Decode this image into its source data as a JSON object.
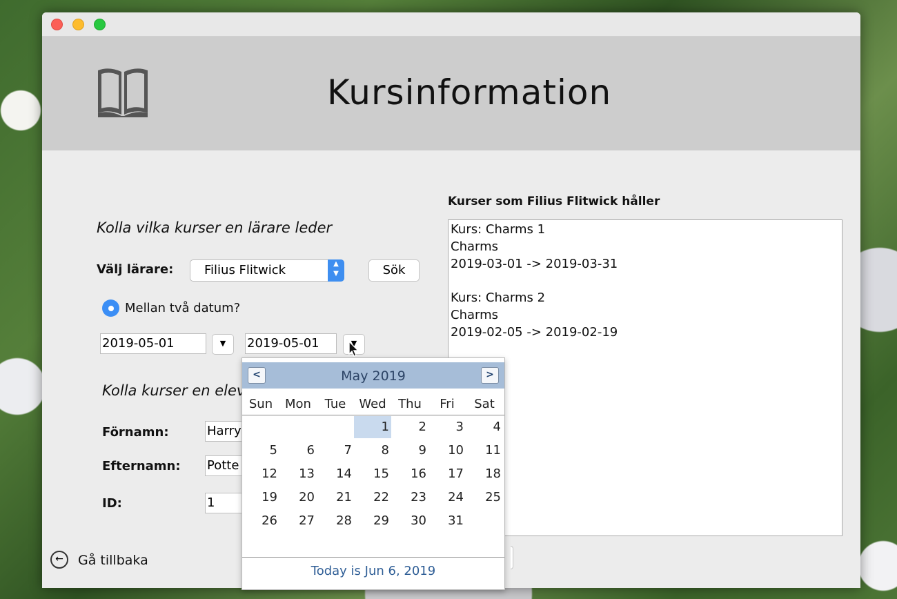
{
  "window": {
    "title": "Kursinformation"
  },
  "teacher_section": {
    "heading": "Kolla vilka kurser en lärare leder",
    "select_label": "Välj lärare:",
    "selected_teacher": "Filius Flitwick",
    "search_button": "Sök",
    "radio_label": "Mellan två datum?",
    "date_from": "2019-05-01",
    "date_to": "2019-05-01"
  },
  "student_section": {
    "heading": "Kolla kurser en elev",
    "firstname_label": "Förnamn:",
    "firstname_value": "Harry",
    "lastname_label": "Efternamn:",
    "lastname_value": "Potte",
    "id_label": "ID:",
    "id_value": "1"
  },
  "results": {
    "heading": "Kurser som Filius Flitwick håller",
    "lines": [
      "Kurs: Charms 1",
      "Charms",
      "2019-03-01 -> 2019-03-31",
      "",
      "Kurs: Charms 2",
      "Charms",
      "2019-02-05 -> 2019-02-19"
    ]
  },
  "back_button": {
    "label": "Gå tillbaka"
  },
  "calendar": {
    "month_label": "May 2019",
    "prev_label": "<",
    "next_label": ">",
    "weekdays": [
      "Sun",
      "Mon",
      "Tue",
      "Wed",
      "Thu",
      "Fri",
      "Sat"
    ],
    "first_weekday_index": 3,
    "days_in_month": 31,
    "selected_day": 1,
    "today_label": "Today is Jun 6, 2019"
  },
  "icons": {
    "app_icon": "book-icon",
    "back_icon": "arrow-left-circle-icon",
    "combo_icon": "chevron-updown-icon",
    "dropdown_icon": "triangle-down-icon",
    "radio_icon": "radio-selected-icon"
  },
  "colors": {
    "header_bg": "#cdcdcd",
    "accent_blue": "#3b8ef5",
    "calendar_header": "#a6bdd8",
    "calendar_selected": "#c9daee"
  }
}
